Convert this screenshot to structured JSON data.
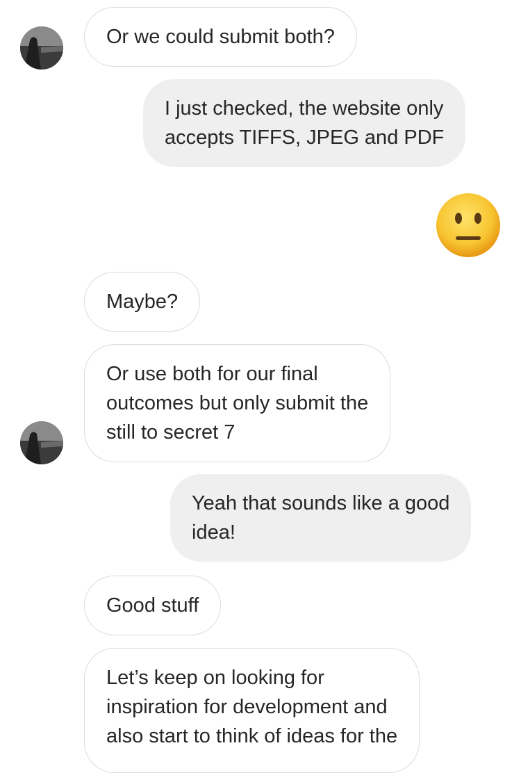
{
  "messages": [
    {
      "id": "m1",
      "direction": "incoming",
      "text": "Or we could submit both?"
    },
    {
      "id": "m2",
      "direction": "outgoing",
      "text": "I just checked, the website only\naccepts TIFFS, JPEG and PDF"
    },
    {
      "id": "m3",
      "direction": "outgoing",
      "emoji": "neutral-face-emoji"
    },
    {
      "id": "m4",
      "direction": "incoming",
      "text": "Maybe?"
    },
    {
      "id": "m5",
      "direction": "incoming",
      "text": "Or use both for our final\noutcomes but only submit the\nstill to secret 7"
    },
    {
      "id": "m6",
      "direction": "outgoing",
      "text": "Yeah that sounds like a good\nidea!"
    },
    {
      "id": "m7",
      "direction": "incoming",
      "text": "Good stuff"
    },
    {
      "id": "m8",
      "direction": "incoming",
      "text": "Let’s keep on looking for\ninspiration for development and\nalso start to think of ideas for the"
    }
  ],
  "colors": {
    "incoming_bg": "#ffffff",
    "incoming_border": "#dbdbdb",
    "outgoing_bg": "#efefef",
    "text": "#262626",
    "emoji_face": "#f7c531"
  }
}
